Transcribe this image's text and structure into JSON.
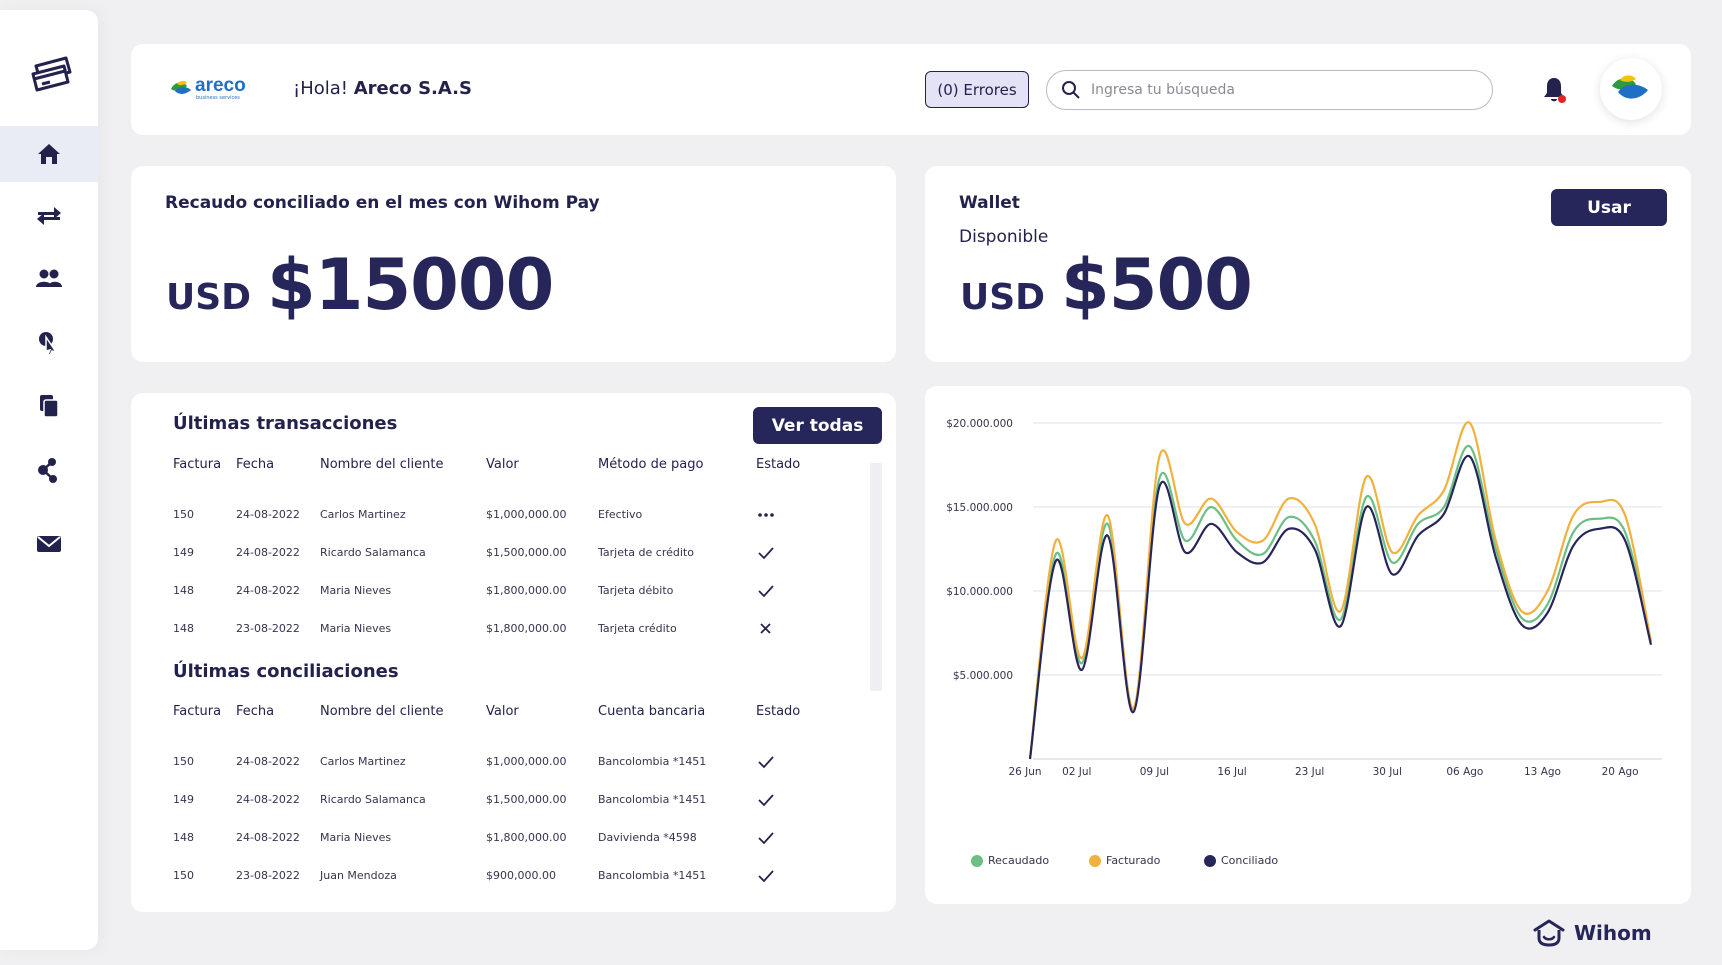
{
  "header": {
    "brand_name": "areco",
    "brand_tagline": "business services",
    "greeting_prefix": "¡Hola!",
    "greeting_name": "Areco S.A.S",
    "errors_label": "(0) Errores",
    "search_placeholder": "Ingresa tu búsqueda"
  },
  "sidebar": {
    "items": [
      {
        "icon": "home-icon",
        "active": true
      },
      {
        "icon": "transfer-icon",
        "active": false
      },
      {
        "icon": "users-icon",
        "active": false
      },
      {
        "icon": "cursor-click-icon",
        "active": false
      },
      {
        "icon": "documents-icon",
        "active": false
      },
      {
        "icon": "share-icon",
        "active": false
      },
      {
        "icon": "mail-icon",
        "active": false
      }
    ]
  },
  "recaudo": {
    "title": "Recaudo conciliado en el mes con Wihom Pay",
    "currency": "USD",
    "amount": "$15000"
  },
  "wallet": {
    "title": "Wallet",
    "subtitle": "Disponible",
    "currency": "USD",
    "amount": "$500",
    "button_label": "Usar"
  },
  "transactions": {
    "title": "Últimas transacciones",
    "button_label": "Ver todas",
    "columns": [
      "Factura",
      "Fecha",
      "Nombre del cliente",
      "Valor",
      "Método de pago",
      "Estado"
    ],
    "rows": [
      {
        "factura": "150",
        "fecha": "24-08-2022",
        "cliente": "Carlos Martinez",
        "valor": "$1,000,000.00",
        "metodo": "Efectivo",
        "estado": "pending"
      },
      {
        "factura": "149",
        "fecha": "24-08-2022",
        "cliente": "Ricardo Salamanca",
        "valor": "$1,500,000.00",
        "metodo": "Tarjeta de crédito",
        "estado": "ok"
      },
      {
        "factura": "148",
        "fecha": "24-08-2022",
        "cliente": "Maria Nieves",
        "valor": "$1,800,000.00",
        "metodo": "Tarjeta débito",
        "estado": "ok"
      },
      {
        "factura": "148",
        "fecha": "23-08-2022",
        "cliente": "Maria Nieves",
        "valor": "$1,800,000.00",
        "metodo": "Tarjeta crédito",
        "estado": "failed"
      }
    ]
  },
  "reconciliations": {
    "title": "Últimas conciliaciones",
    "columns": [
      "Factura",
      "Fecha",
      "Nombre del cliente",
      "Valor",
      "Cuenta bancaria",
      "Estado"
    ],
    "rows": [
      {
        "factura": "150",
        "fecha": "24-08-2022",
        "cliente": "Carlos Martinez",
        "valor": "$1,000,000.00",
        "cuenta": "Bancolombia *1451",
        "estado": "ok"
      },
      {
        "factura": "149",
        "fecha": "24-08-2022",
        "cliente": "Ricardo Salamanca",
        "valor": "$1,500,000.00",
        "cuenta": "Bancolombia *1451",
        "estado": "ok"
      },
      {
        "factura": "148",
        "fecha": "24-08-2022",
        "cliente": "Maria Nieves",
        "valor": "$1,800,000.00",
        "cuenta": "Davivienda *4598",
        "estado": "ok"
      },
      {
        "factura": "150",
        "fecha": "23-08-2022",
        "cliente": "Juan Mendoza",
        "valor": "$900,000.00",
        "cuenta": "Bancolombia *1451",
        "estado": "ok"
      }
    ]
  },
  "chart_data": {
    "type": "line",
    "title": "",
    "xlabel": "",
    "ylabel": "",
    "ylim": [
      0,
      20000000
    ],
    "y_ticks": [
      "$5.000.000",
      "$10.000.000",
      "$15.000.000",
      "$20.000.000"
    ],
    "y_tick_values": [
      5000000,
      10000000,
      15000000,
      20000000
    ],
    "x_ticks": [
      "26 Jun",
      "02 Jul",
      "09 Jul",
      "16 Jul",
      "23 Jul",
      "30 Jul",
      "06 Ago",
      "13 Ago",
      "20 Ago"
    ],
    "x": [
      "26 Jun",
      "29 Jun",
      "02 Jul",
      "05 Jul",
      "07 Jul",
      "09 Jul",
      "12 Jul",
      "14 Jul",
      "16 Jul",
      "19 Jul",
      "21 Jul",
      "23 Jul",
      "26 Jul",
      "28 Jul",
      "30 Jul",
      "02 Ago",
      "04 Ago",
      "06 Ago",
      "09 Ago",
      "11 Ago",
      "13 Ago",
      "16 Ago",
      "18 Ago",
      "20 Ago",
      "23 Ago"
    ],
    "series": [
      {
        "name": "Recaudado",
        "color": "#6cbf84",
        "values": [
          0,
          12200000,
          5700000,
          14000000,
          3000000,
          16700000,
          13000000,
          15000000,
          13000000,
          12200000,
          14400000,
          13000000,
          8300000,
          15600000,
          11700000,
          14000000,
          15000000,
          18600000,
          12500000,
          8400000,
          9200000,
          13500000,
          14300000,
          13500000,
          7000000
        ]
      },
      {
        "name": "Facturado",
        "color": "#f0b13d",
        "values": [
          0,
          13000000,
          6000000,
          14500000,
          3000000,
          18000000,
          14000000,
          15500000,
          13500000,
          13000000,
          15500000,
          14000000,
          8800000,
          16800000,
          12300000,
          14500000,
          16000000,
          20000000,
          13000000,
          8800000,
          10000000,
          14500000,
          15300000,
          14500000,
          7000000
        ]
      },
      {
        "name": "Conciliado",
        "color": "#27265a",
        "values": [
          0,
          11800000,
          5300000,
          13300000,
          2800000,
          16200000,
          12300000,
          14000000,
          12300000,
          11700000,
          13700000,
          12500000,
          7900000,
          15000000,
          11000000,
          13300000,
          14600000,
          18000000,
          12000000,
          8000000,
          8700000,
          12700000,
          13700000,
          13000000,
          6800000
        ]
      }
    ],
    "legend_position": "bottom-left",
    "grid": true
  },
  "footer": {
    "brand": "Wihom"
  }
}
